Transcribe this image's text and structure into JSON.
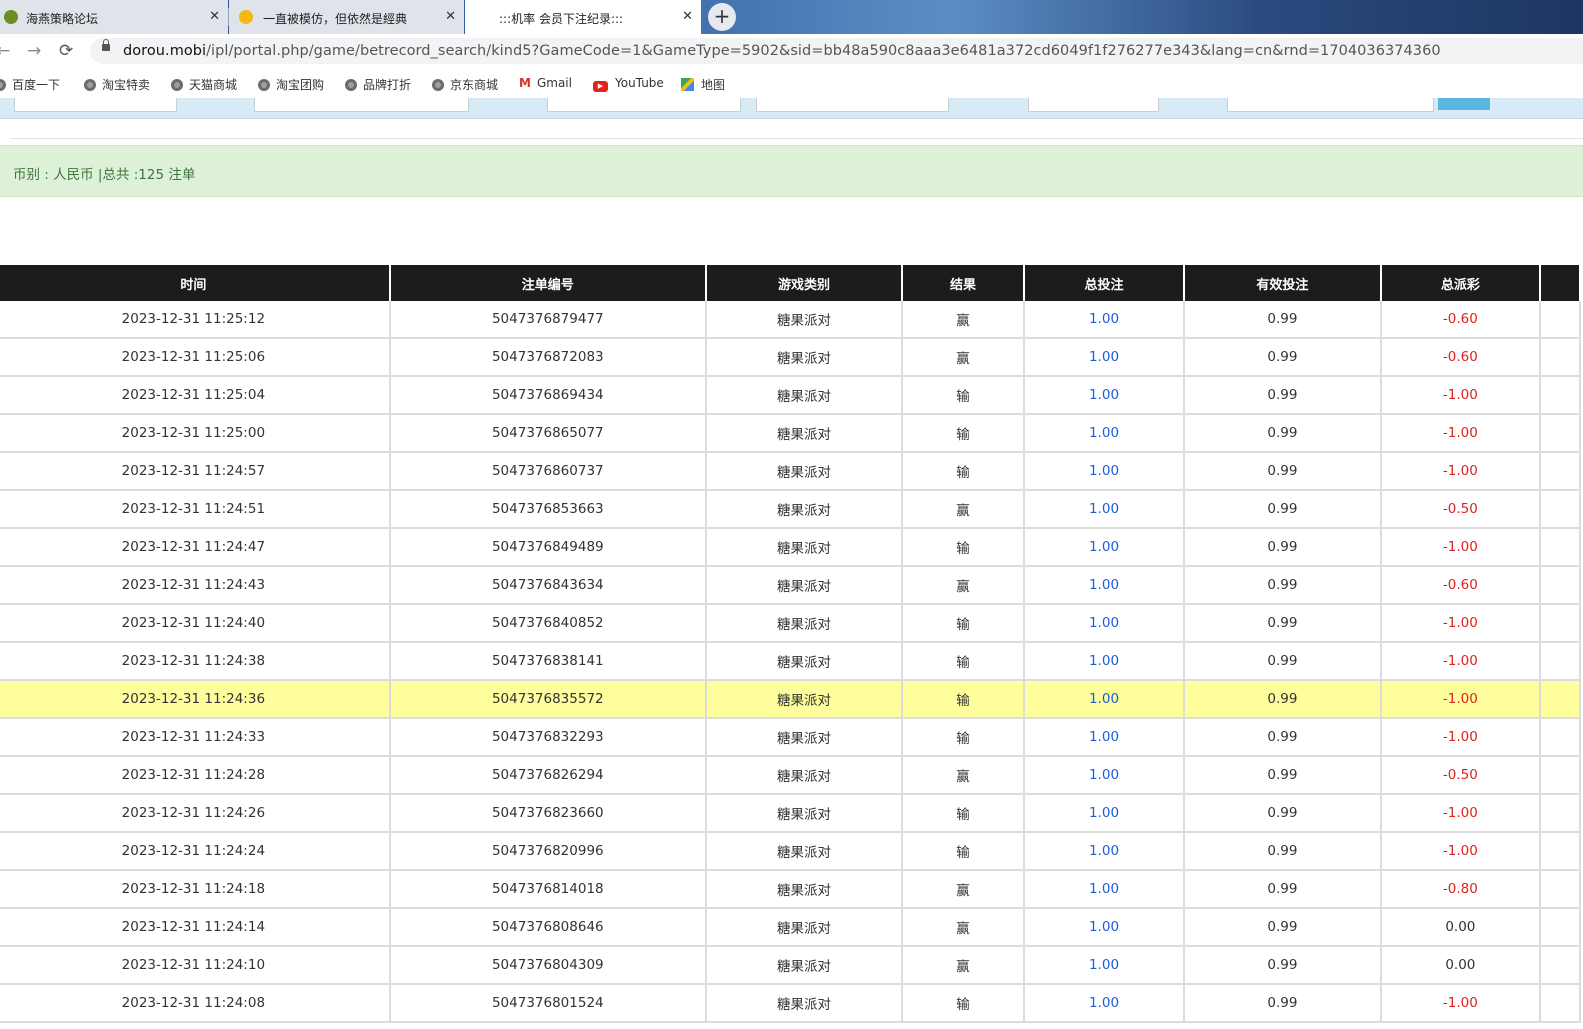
{
  "browser": {
    "tabs": [
      {
        "title": "海燕策略论坛",
        "favicon_color": "#6b8e23"
      },
      {
        "title": "一直被模仿，但依然是經典",
        "favicon_color": "#f5b80f"
      },
      {
        "title": ":::机率 会员下注纪录:::",
        "favicon_color": ""
      }
    ],
    "url_host": "dorou.mobi",
    "url_path": "/ipl/portal.php/game/betrecord_search/kind5?GameCode=1&GameType=5902&sid=bb48a590c8aaa3e6481a372cd6049f1f276277e343&lang=cn&rnd=1704036374360",
    "bookmarks": [
      {
        "label": "百度一下",
        "icon": "globe-icon"
      },
      {
        "label": "淘宝特卖",
        "icon": "globe-icon"
      },
      {
        "label": "天猫商城",
        "icon": "globe-icon"
      },
      {
        "label": "淘宝团购",
        "icon": "globe-icon"
      },
      {
        "label": "品牌打折",
        "icon": "globe-icon"
      },
      {
        "label": "京东商城",
        "icon": "globe-icon"
      },
      {
        "label": "Gmail",
        "icon": "gmail-icon"
      },
      {
        "label": "YouTube",
        "icon": "youtube-icon"
      },
      {
        "label": "地图",
        "icon": "maps-icon"
      }
    ]
  },
  "summary": "币别 : 人民币 |总共 :125 注单",
  "table": {
    "headers": [
      "时间",
      "注单编号",
      "游戏类别",
      "结果",
      "总投注",
      "有效投注",
      "总派彩"
    ],
    "rows": [
      {
        "time": "2023-12-31 11:25:12",
        "id": "5047376879477",
        "game": "糖果派对",
        "result": "赢",
        "bet": "1.00",
        "valid": "0.99",
        "payout": "-0.60"
      },
      {
        "time": "2023-12-31 11:25:06",
        "id": "5047376872083",
        "game": "糖果派对",
        "result": "赢",
        "bet": "1.00",
        "valid": "0.99",
        "payout": "-0.60"
      },
      {
        "time": "2023-12-31 11:25:04",
        "id": "5047376869434",
        "game": "糖果派对",
        "result": "输",
        "bet": "1.00",
        "valid": "0.99",
        "payout": "-1.00"
      },
      {
        "time": "2023-12-31 11:25:00",
        "id": "5047376865077",
        "game": "糖果派对",
        "result": "输",
        "bet": "1.00",
        "valid": "0.99",
        "payout": "-1.00"
      },
      {
        "time": "2023-12-31 11:24:57",
        "id": "5047376860737",
        "game": "糖果派对",
        "result": "输",
        "bet": "1.00",
        "valid": "0.99",
        "payout": "-1.00"
      },
      {
        "time": "2023-12-31 11:24:51",
        "id": "5047376853663",
        "game": "糖果派对",
        "result": "赢",
        "bet": "1.00",
        "valid": "0.99",
        "payout": "-0.50"
      },
      {
        "time": "2023-12-31 11:24:47",
        "id": "5047376849489",
        "game": "糖果派对",
        "result": "输",
        "bet": "1.00",
        "valid": "0.99",
        "payout": "-1.00"
      },
      {
        "time": "2023-12-31 11:24:43",
        "id": "5047376843634",
        "game": "糖果派对",
        "result": "赢",
        "bet": "1.00",
        "valid": "0.99",
        "payout": "-0.60"
      },
      {
        "time": "2023-12-31 11:24:40",
        "id": "5047376840852",
        "game": "糖果派对",
        "result": "输",
        "bet": "1.00",
        "valid": "0.99",
        "payout": "-1.00"
      },
      {
        "time": "2023-12-31 11:24:38",
        "id": "5047376838141",
        "game": "糖果派对",
        "result": "输",
        "bet": "1.00",
        "valid": "0.99",
        "payout": "-1.00"
      },
      {
        "time": "2023-12-31 11:24:36",
        "id": "5047376835572",
        "game": "糖果派对",
        "result": "输",
        "bet": "1.00",
        "valid": "0.99",
        "payout": "-1.00"
      },
      {
        "time": "2023-12-31 11:24:33",
        "id": "5047376832293",
        "game": "糖果派对",
        "result": "输",
        "bet": "1.00",
        "valid": "0.99",
        "payout": "-1.00"
      },
      {
        "time": "2023-12-31 11:24:28",
        "id": "5047376826294",
        "game": "糖果派对",
        "result": "赢",
        "bet": "1.00",
        "valid": "0.99",
        "payout": "-0.50"
      },
      {
        "time": "2023-12-31 11:24:26",
        "id": "5047376823660",
        "game": "糖果派对",
        "result": "输",
        "bet": "1.00",
        "valid": "0.99",
        "payout": "-1.00"
      },
      {
        "time": "2023-12-31 11:24:24",
        "id": "5047376820996",
        "game": "糖果派对",
        "result": "输",
        "bet": "1.00",
        "valid": "0.99",
        "payout": "-1.00"
      },
      {
        "time": "2023-12-31 11:24:18",
        "id": "5047376814018",
        "game": "糖果派对",
        "result": "赢",
        "bet": "1.00",
        "valid": "0.99",
        "payout": "-0.80"
      },
      {
        "time": "2023-12-31 11:24:14",
        "id": "5047376808646",
        "game": "糖果派对",
        "result": "赢",
        "bet": "1.00",
        "valid": "0.99",
        "payout": "0.00"
      },
      {
        "time": "2023-12-31 11:24:10",
        "id": "5047376804309",
        "game": "糖果派对",
        "result": "赢",
        "bet": "1.00",
        "valid": "0.99",
        "payout": "0.00"
      },
      {
        "time": "2023-12-31 11:24:08",
        "id": "5047376801524",
        "game": "糖果派对",
        "result": "输",
        "bet": "1.00",
        "valid": "0.99",
        "payout": "-1.00"
      }
    ],
    "highlighted_row_index": 10
  },
  "colors": {
    "header_bg": "#1c1c1c",
    "bet_blue": "#1a5fd6",
    "negative_red": "#e0211d",
    "highlight_yellow": "#fefe9c",
    "summary_green_bg": "#dff0d8"
  }
}
